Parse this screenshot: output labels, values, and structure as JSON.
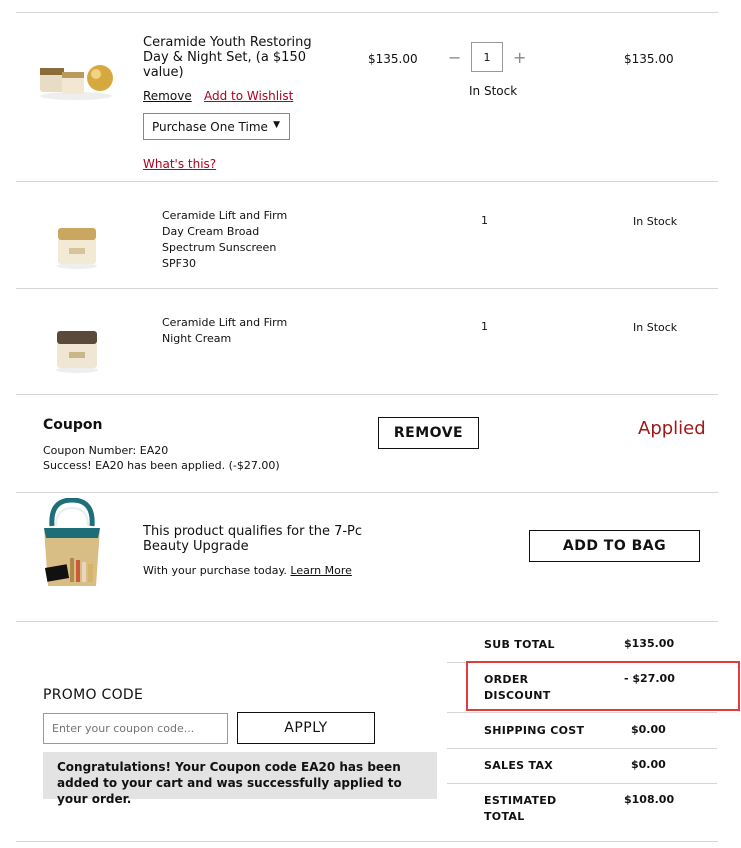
{
  "item1": {
    "name": "Ceramide Youth Restoring Day & Night Set, (a $150 value)",
    "price": "$135.00",
    "quantity": "1",
    "stock": "In Stock",
    "total": "$135.00",
    "remove_label": "Remove",
    "wishlist_label": "Add to Wishlist",
    "purchase_option": "Purchase One Time",
    "whats_this_label": "What's this?"
  },
  "item2": {
    "name": "Ceramide Lift and Firm Day Cream Broad Spectrum Sunscreen SPF30",
    "quantity": "1",
    "stock": "In Stock"
  },
  "item3": {
    "name": "Ceramide Lift and Firm Night Cream",
    "quantity": "1",
    "stock": "In Stock"
  },
  "coupon": {
    "title": "Coupon",
    "number_text": "Coupon Number: EA20",
    "success_text": "Success! EA20 has been applied. (-$27.00)",
    "remove_label": "REMOVE",
    "status": "Applied"
  },
  "upgrade": {
    "title": "This product qualifies for the 7-Pc Beauty Upgrade",
    "text": "With your purchase today.",
    "learn_more": "Learn More",
    "add_label": "ADD TO BAG"
  },
  "promo": {
    "heading": "PROMO CODE",
    "placeholder": "Enter your coupon code...",
    "apply_label": "APPLY",
    "message": "Congratulations! Your Coupon code EA20 has been added to your cart and was successfully applied to your order."
  },
  "summary": {
    "subtotal_label": "SUB TOTAL",
    "subtotal_value": "$135.00",
    "discount_label": "ORDER DISCOUNT",
    "discount_value": "- $27.00",
    "shipping_label": "SHIPPING COST",
    "shipping_value": "$0.00",
    "tax_label": "SALES TAX",
    "tax_value": "$0.00",
    "total_label": "ESTIMATED TOTAL",
    "total_value": "$108.00"
  },
  "colors": {
    "accent_red": "#b3001e",
    "highlight_box": "#e03c3c",
    "message_bg": "#e3e3e3"
  }
}
